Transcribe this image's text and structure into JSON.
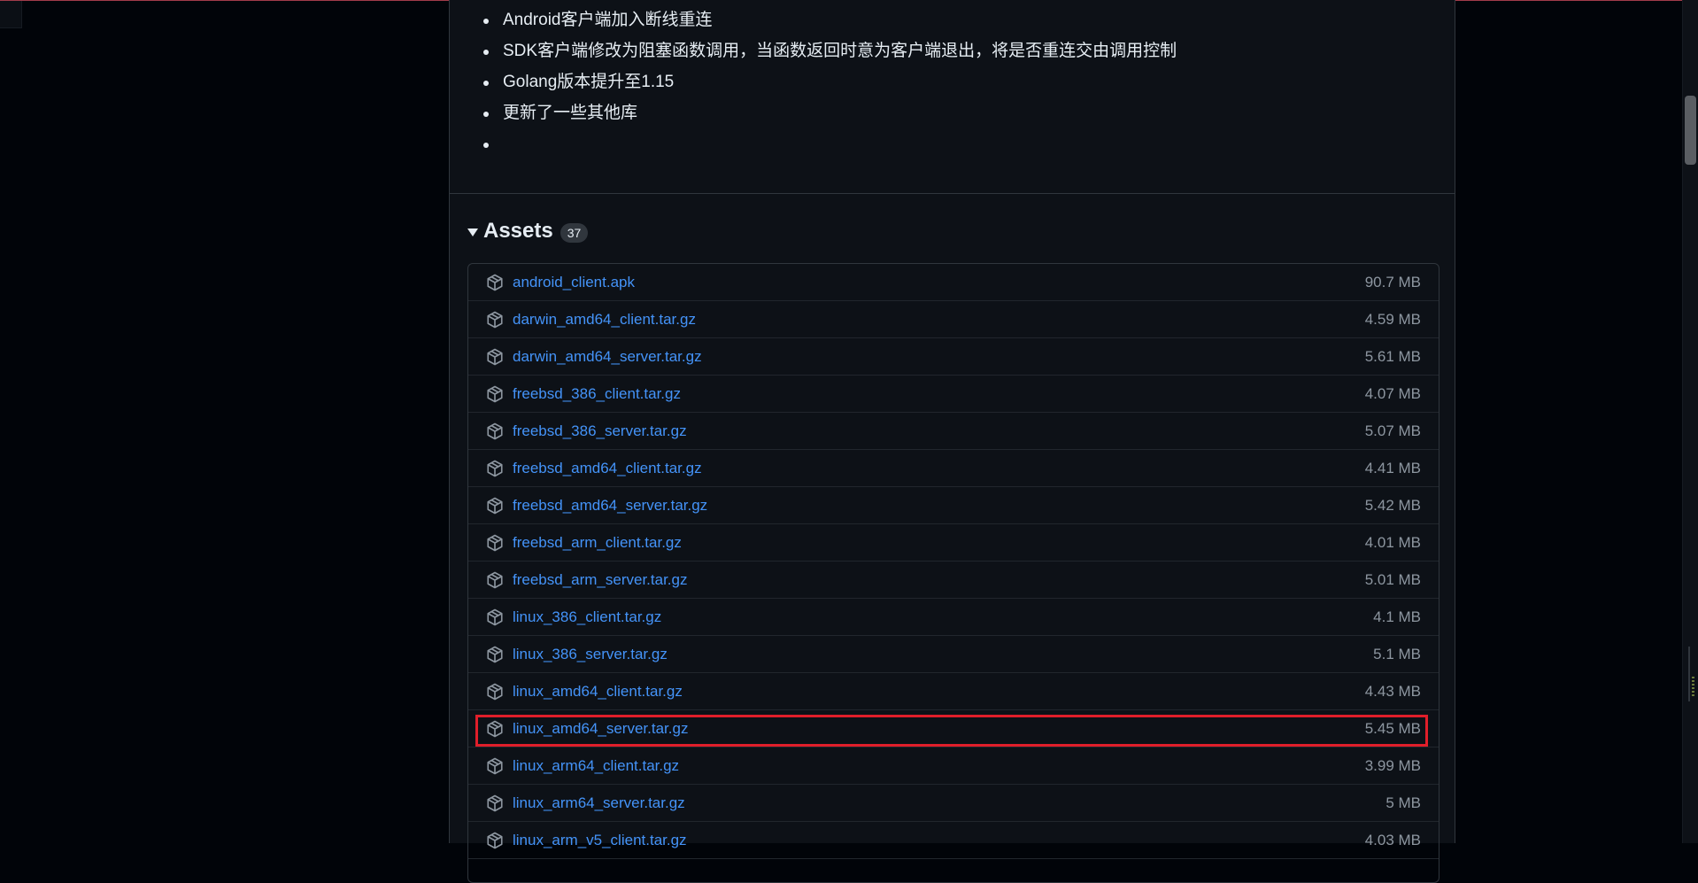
{
  "release_notes": {
    "items": [
      "Android客户端加入断线重连",
      "SDK客户端修改为阻塞函数调用，当函数返回时意为客户端退出，将是否重连交由调用控制",
      "Golang版本提升至1.15",
      "更新了一些其他库",
      ""
    ]
  },
  "assets": {
    "title": "Assets",
    "count": "37",
    "icon": "package-icon",
    "files": [
      {
        "name": "android_client.apk",
        "size": "90.7 MB"
      },
      {
        "name": "darwin_amd64_client.tar.gz",
        "size": "4.59 MB"
      },
      {
        "name": "darwin_amd64_server.tar.gz",
        "size": "5.61 MB"
      },
      {
        "name": "freebsd_386_client.tar.gz",
        "size": "4.07 MB"
      },
      {
        "name": "freebsd_386_server.tar.gz",
        "size": "5.07 MB"
      },
      {
        "name": "freebsd_amd64_client.tar.gz",
        "size": "4.41 MB"
      },
      {
        "name": "freebsd_amd64_server.tar.gz",
        "size": "5.42 MB"
      },
      {
        "name": "freebsd_arm_client.tar.gz",
        "size": "4.01 MB"
      },
      {
        "name": "freebsd_arm_server.tar.gz",
        "size": "5.01 MB"
      },
      {
        "name": "linux_386_client.tar.gz",
        "size": "4.1 MB"
      },
      {
        "name": "linux_386_server.tar.gz",
        "size": "5.1 MB"
      },
      {
        "name": "linux_amd64_client.tar.gz",
        "size": "4.43 MB"
      },
      {
        "name": "linux_amd64_server.tar.gz",
        "size": "5.45 MB",
        "highlighted": true
      },
      {
        "name": "linux_arm64_client.tar.gz",
        "size": "3.99 MB"
      },
      {
        "name": "linux_arm64_server.tar.gz",
        "size": "5 MB"
      },
      {
        "name": "linux_arm_v5_client.tar.gz",
        "size": "4.03 MB"
      }
    ]
  },
  "colors": {
    "page_bg": "#010409",
    "card_bg": "#0d1117",
    "border": "#30363d",
    "link": "#4493f8",
    "muted": "#8d96a0",
    "highlight": "#e01e2a"
  }
}
